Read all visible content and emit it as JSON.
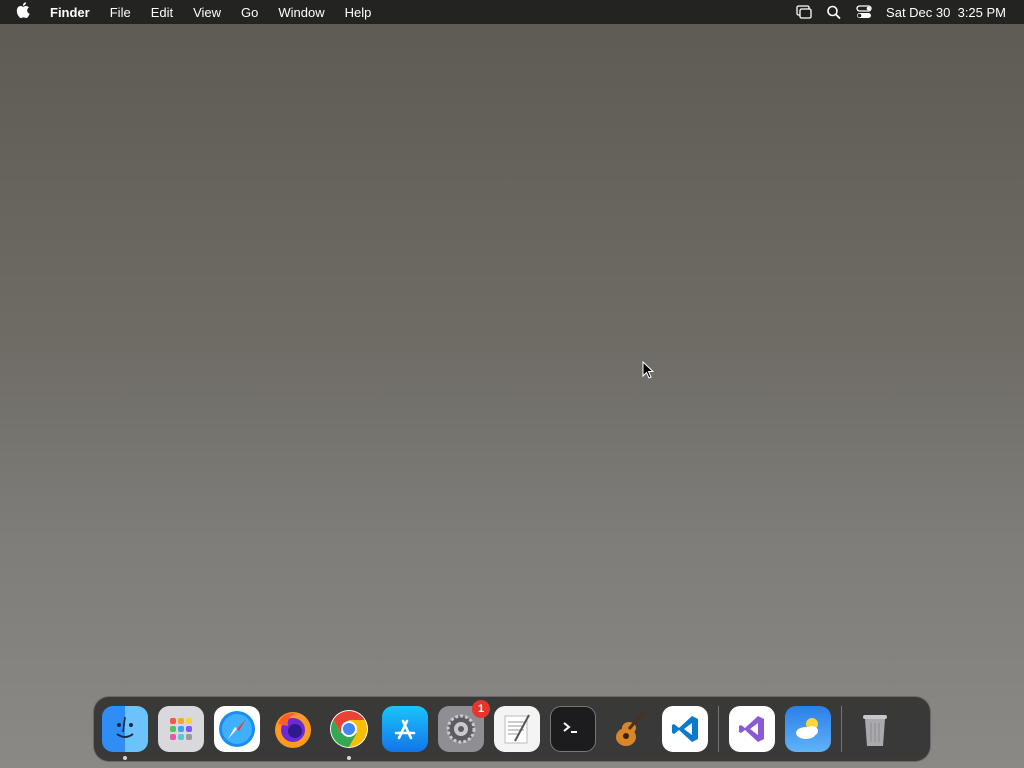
{
  "menubar": {
    "apple_icon": "apple-icon",
    "app_name": "Finder",
    "menus": [
      "File",
      "Edit",
      "View",
      "Go",
      "Window",
      "Help"
    ],
    "status_icons": [
      "screen-mirroring-icon",
      "spotlight-search-icon",
      "control-center-icon"
    ],
    "clock": "Sat Dec 30  3:25 PM"
  },
  "dock": {
    "apps": [
      {
        "name": "Finder",
        "icon": "finder-icon",
        "running": true
      },
      {
        "name": "Launchpad",
        "icon": "launchpad-icon",
        "running": false
      },
      {
        "name": "Safari",
        "icon": "safari-icon",
        "running": false
      },
      {
        "name": "Firefox",
        "icon": "firefox-icon",
        "running": false
      },
      {
        "name": "Google Chrome",
        "icon": "chrome-icon",
        "running": true
      },
      {
        "name": "App Store",
        "icon": "app-store-icon",
        "running": false
      },
      {
        "name": "System Settings",
        "icon": "system-settings-icon",
        "running": false,
        "badge": "1"
      },
      {
        "name": "TextEdit",
        "icon": "textedit-icon",
        "running": false
      },
      {
        "name": "Terminal",
        "icon": "terminal-icon",
        "running": false
      },
      {
        "name": "GarageBand",
        "icon": "garageband-icon",
        "running": false
      },
      {
        "name": "Visual Studio Code",
        "icon": "vscode-icon",
        "running": false
      }
    ],
    "apps2": [
      {
        "name": "Visual Studio",
        "icon": "visual-studio-icon"
      },
      {
        "name": "Weather",
        "icon": "weather-icon"
      }
    ],
    "trash": {
      "name": "Trash",
      "icon": "trash-icon"
    },
    "system_settings_badge": "1"
  },
  "colors": {
    "menubar_bg": "#1e1e1e",
    "badge": "#e5362b",
    "vscode_blue": "#0a7acc"
  }
}
